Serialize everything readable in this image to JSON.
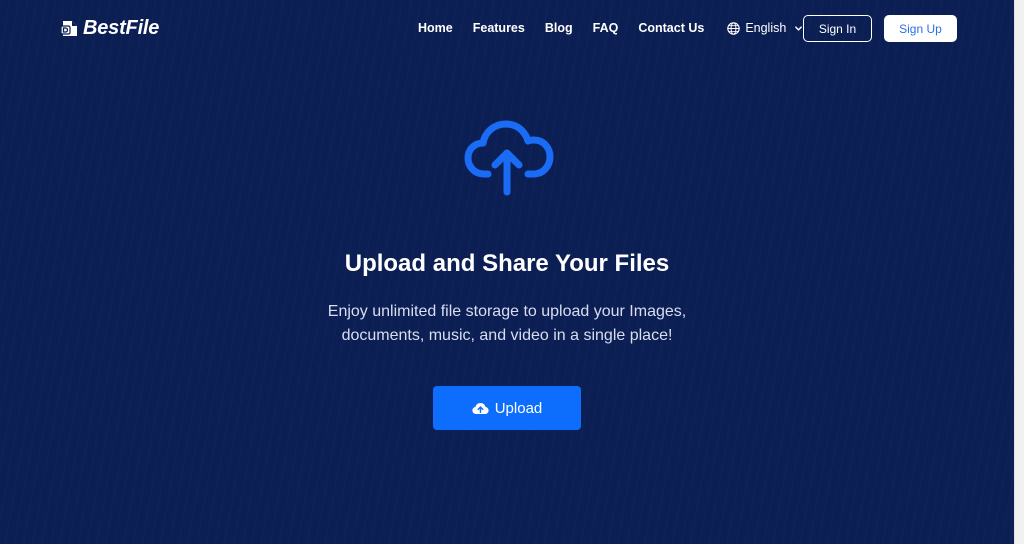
{
  "brand": {
    "name": "BestFile",
    "logo_icon": "file-logo-icon"
  },
  "nav": {
    "links": [
      "Home",
      "Features",
      "Blog",
      "FAQ",
      "Contact Us"
    ],
    "language": {
      "label": "English",
      "icon": "globe-icon",
      "dropdown_icon": "chevron-down-icon"
    }
  },
  "auth": {
    "sign_in": "Sign In",
    "sign_up": "Sign Up"
  },
  "hero": {
    "icon": "cloud-upload-icon",
    "title": "Upload and Share Your Files",
    "description_line1": "Enjoy unlimited file storage to upload your Images,",
    "description_line2": "documents, music, and video in a single place!",
    "upload_button": {
      "label": "Upload",
      "icon": "cloud-upload-icon"
    }
  },
  "colors": {
    "background": "#0c1f54",
    "accent": "#0d6efd",
    "hero_icon": "#1a6cf5",
    "sign_up_text": "#2d6fe8",
    "text": "#ffffff"
  }
}
